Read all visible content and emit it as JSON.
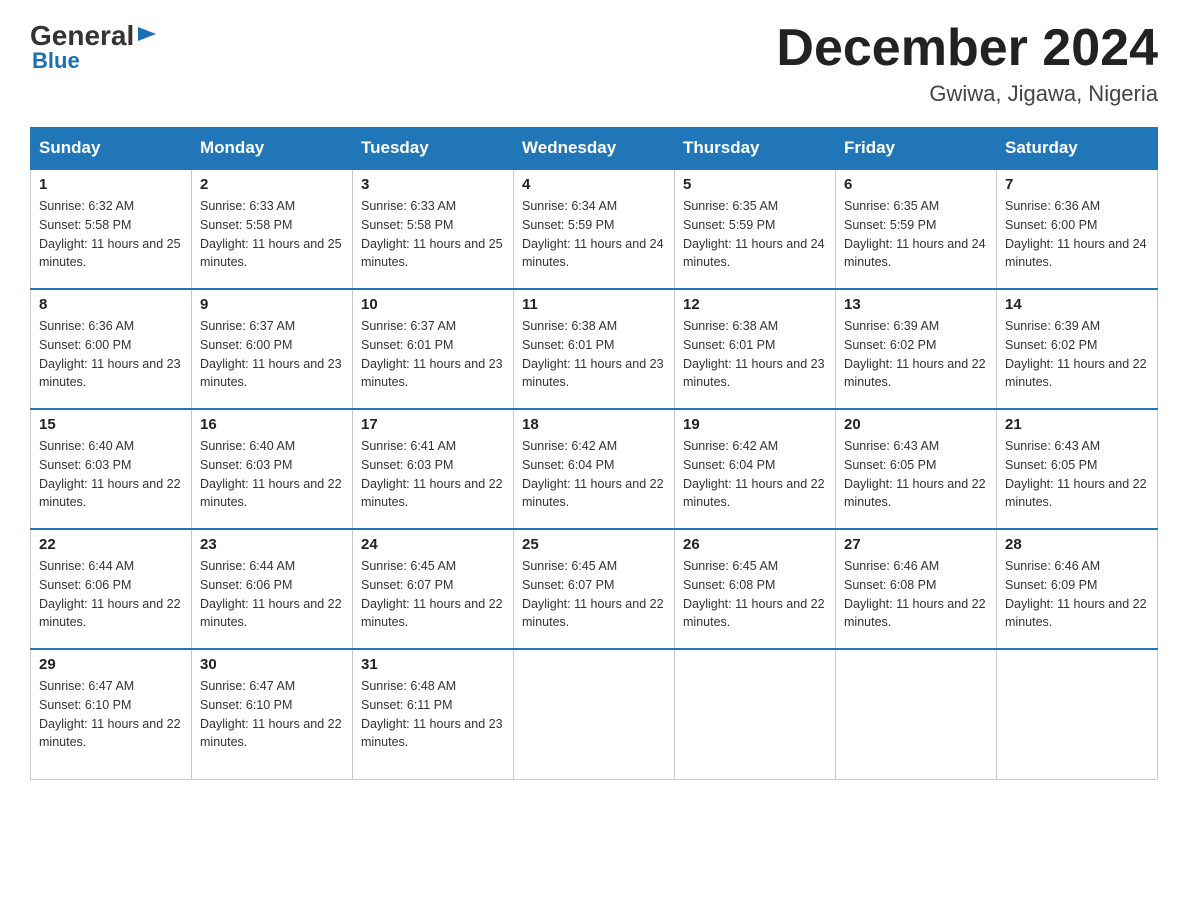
{
  "header": {
    "logo_general": "General",
    "logo_blue": "Blue",
    "month_title": "December 2024",
    "location": "Gwiwa, Jigawa, Nigeria"
  },
  "weekdays": [
    "Sunday",
    "Monday",
    "Tuesday",
    "Wednesday",
    "Thursday",
    "Friday",
    "Saturday"
  ],
  "weeks": [
    [
      {
        "day": "1",
        "sunrise": "6:32 AM",
        "sunset": "5:58 PM",
        "daylight": "11 hours and 25 minutes."
      },
      {
        "day": "2",
        "sunrise": "6:33 AM",
        "sunset": "5:58 PM",
        "daylight": "11 hours and 25 minutes."
      },
      {
        "day": "3",
        "sunrise": "6:33 AM",
        "sunset": "5:58 PM",
        "daylight": "11 hours and 25 minutes."
      },
      {
        "day": "4",
        "sunrise": "6:34 AM",
        "sunset": "5:59 PM",
        "daylight": "11 hours and 24 minutes."
      },
      {
        "day": "5",
        "sunrise": "6:35 AM",
        "sunset": "5:59 PM",
        "daylight": "11 hours and 24 minutes."
      },
      {
        "day": "6",
        "sunrise": "6:35 AM",
        "sunset": "5:59 PM",
        "daylight": "11 hours and 24 minutes."
      },
      {
        "day": "7",
        "sunrise": "6:36 AM",
        "sunset": "6:00 PM",
        "daylight": "11 hours and 24 minutes."
      }
    ],
    [
      {
        "day": "8",
        "sunrise": "6:36 AM",
        "sunset": "6:00 PM",
        "daylight": "11 hours and 23 minutes."
      },
      {
        "day": "9",
        "sunrise": "6:37 AM",
        "sunset": "6:00 PM",
        "daylight": "11 hours and 23 minutes."
      },
      {
        "day": "10",
        "sunrise": "6:37 AM",
        "sunset": "6:01 PM",
        "daylight": "11 hours and 23 minutes."
      },
      {
        "day": "11",
        "sunrise": "6:38 AM",
        "sunset": "6:01 PM",
        "daylight": "11 hours and 23 minutes."
      },
      {
        "day": "12",
        "sunrise": "6:38 AM",
        "sunset": "6:01 PM",
        "daylight": "11 hours and 23 minutes."
      },
      {
        "day": "13",
        "sunrise": "6:39 AM",
        "sunset": "6:02 PM",
        "daylight": "11 hours and 22 minutes."
      },
      {
        "day": "14",
        "sunrise": "6:39 AM",
        "sunset": "6:02 PM",
        "daylight": "11 hours and 22 minutes."
      }
    ],
    [
      {
        "day": "15",
        "sunrise": "6:40 AM",
        "sunset": "6:03 PM",
        "daylight": "11 hours and 22 minutes."
      },
      {
        "day": "16",
        "sunrise": "6:40 AM",
        "sunset": "6:03 PM",
        "daylight": "11 hours and 22 minutes."
      },
      {
        "day": "17",
        "sunrise": "6:41 AM",
        "sunset": "6:03 PM",
        "daylight": "11 hours and 22 minutes."
      },
      {
        "day": "18",
        "sunrise": "6:42 AM",
        "sunset": "6:04 PM",
        "daylight": "11 hours and 22 minutes."
      },
      {
        "day": "19",
        "sunrise": "6:42 AM",
        "sunset": "6:04 PM",
        "daylight": "11 hours and 22 minutes."
      },
      {
        "day": "20",
        "sunrise": "6:43 AM",
        "sunset": "6:05 PM",
        "daylight": "11 hours and 22 minutes."
      },
      {
        "day": "21",
        "sunrise": "6:43 AM",
        "sunset": "6:05 PM",
        "daylight": "11 hours and 22 minutes."
      }
    ],
    [
      {
        "day": "22",
        "sunrise": "6:44 AM",
        "sunset": "6:06 PM",
        "daylight": "11 hours and 22 minutes."
      },
      {
        "day": "23",
        "sunrise": "6:44 AM",
        "sunset": "6:06 PM",
        "daylight": "11 hours and 22 minutes."
      },
      {
        "day": "24",
        "sunrise": "6:45 AM",
        "sunset": "6:07 PM",
        "daylight": "11 hours and 22 minutes."
      },
      {
        "day": "25",
        "sunrise": "6:45 AM",
        "sunset": "6:07 PM",
        "daylight": "11 hours and 22 minutes."
      },
      {
        "day": "26",
        "sunrise": "6:45 AM",
        "sunset": "6:08 PM",
        "daylight": "11 hours and 22 minutes."
      },
      {
        "day": "27",
        "sunrise": "6:46 AM",
        "sunset": "6:08 PM",
        "daylight": "11 hours and 22 minutes."
      },
      {
        "day": "28",
        "sunrise": "6:46 AM",
        "sunset": "6:09 PM",
        "daylight": "11 hours and 22 minutes."
      }
    ],
    [
      {
        "day": "29",
        "sunrise": "6:47 AM",
        "sunset": "6:10 PM",
        "daylight": "11 hours and 22 minutes."
      },
      {
        "day": "30",
        "sunrise": "6:47 AM",
        "sunset": "6:10 PM",
        "daylight": "11 hours and 22 minutes."
      },
      {
        "day": "31",
        "sunrise": "6:48 AM",
        "sunset": "6:11 PM",
        "daylight": "11 hours and 23 minutes."
      },
      null,
      null,
      null,
      null
    ]
  ]
}
